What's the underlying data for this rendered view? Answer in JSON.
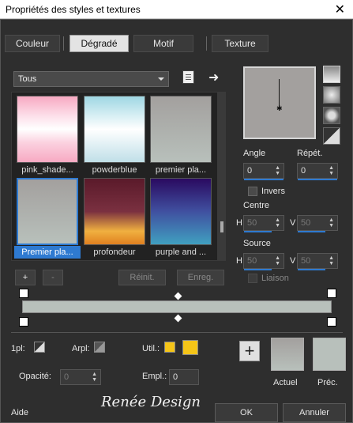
{
  "window": {
    "title": "Propriétés des styles et textures",
    "close": "✕"
  },
  "tabs": [
    {
      "label": "Couleur"
    },
    {
      "label": "Dégradé"
    },
    {
      "label": "Motif"
    },
    {
      "label": "Texture"
    }
  ],
  "library": {
    "selected": "Tous"
  },
  "gradients": [
    {
      "label": "pink_shade...",
      "colors": [
        "#f7a9c2",
        "#fce4ec",
        "#ffffff",
        "#f7a9c2"
      ]
    },
    {
      "label": "powderblue",
      "colors": [
        "#9fd7e3",
        "#ffffff",
        "#c0dfe8"
      ]
    },
    {
      "label": "premier pla...",
      "colors": [
        "#a3a09e",
        "#b8c0bb"
      ]
    },
    {
      "label": "Premier pla...",
      "colors": [
        "#a3a09e",
        "#b8c0bb"
      ]
    },
    {
      "label": "profondeur",
      "colors": [
        "#5a1a2a",
        "#7a3040",
        "#f0b040",
        "#e08020"
      ]
    },
    {
      "label": "purple and ...",
      "colors": [
        "#2a0a60",
        "#4050a0",
        "#40a0c0"
      ]
    }
  ],
  "buttons": {
    "add": "+",
    "remove": "-",
    "reset": "Réinit.",
    "save": "Enreg.",
    "ok": "OK",
    "cancel": "Annuler",
    "help": "Aide",
    "plus": "+"
  },
  "angle": {
    "label": "Angle",
    "value": "0"
  },
  "repeat": {
    "label": "Répét.",
    "value": "0"
  },
  "invert": {
    "label": "Invers"
  },
  "center": {
    "label": "Centre",
    "h_label": "H",
    "h": "50",
    "v_label": "V",
    "v": "50"
  },
  "source": {
    "label": "Source",
    "h_label": "H",
    "h": "50",
    "v_label": "V",
    "v": "50"
  },
  "link": {
    "label": "Liaison"
  },
  "stops": {
    "first_label": "1pl:",
    "fg_label": "Arpl:",
    "user_label": "Util.:",
    "opacity_label": "Opacité:",
    "opacity": "0",
    "location_label": "Empl.:",
    "location": "0"
  },
  "colors": {
    "fg": "#a3a09e",
    "bg": "#b8c0bb",
    "user": "#f5c518",
    "accent": "#2e7ad1"
  },
  "current": {
    "actuel": "Actuel",
    "prec": "Préc."
  },
  "logo": "Renée Design"
}
